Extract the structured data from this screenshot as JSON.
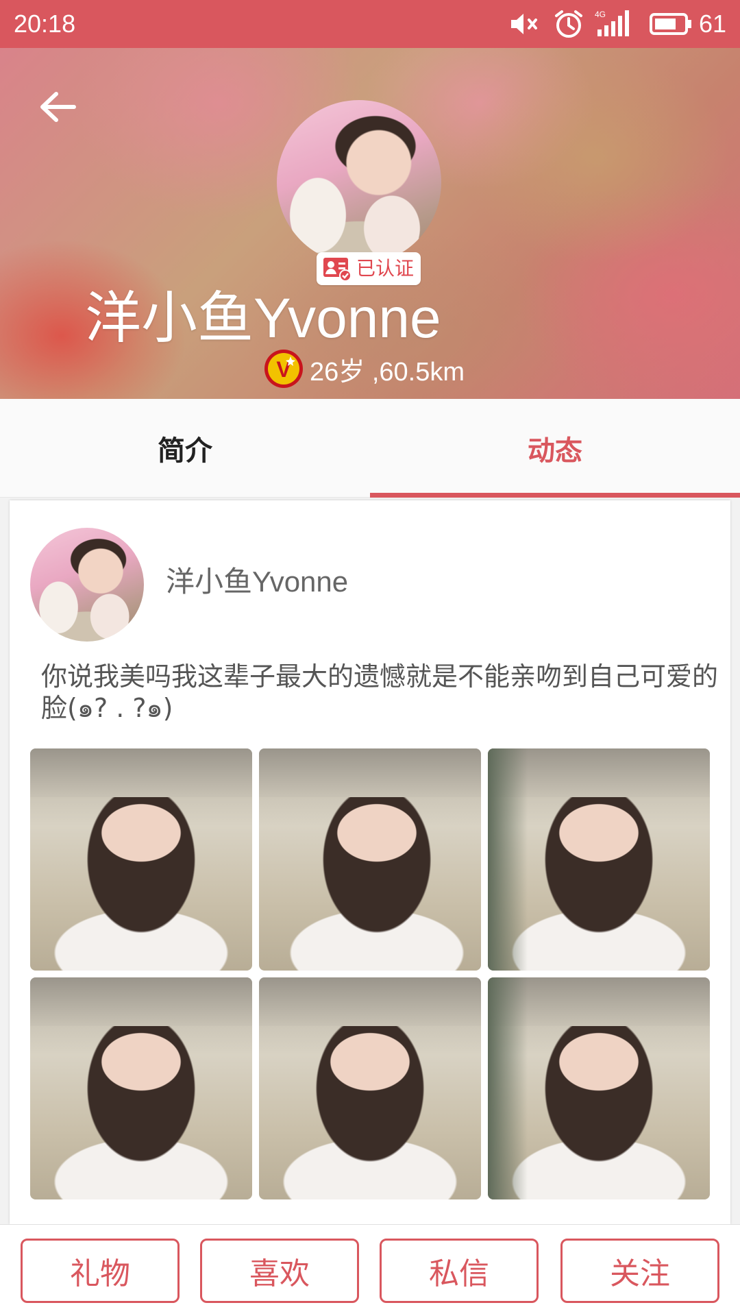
{
  "status_bar": {
    "time": "20:18",
    "network": "4G",
    "battery": "61",
    "icons": [
      "mute-icon",
      "alarm-icon",
      "signal-icon",
      "battery-icon"
    ]
  },
  "header": {
    "back_icon": "arrow-left-icon",
    "name": "洋小鱼Yvonne",
    "verified_label": "已认证",
    "vip_badge": "V",
    "meta": "26岁 ,60.5km"
  },
  "tabs": [
    {
      "label": "简介",
      "active": false
    },
    {
      "label": "动态",
      "active": true
    }
  ],
  "post": {
    "author": "洋小鱼Yvonne",
    "text": "你说我美吗我这辈子最大的遗憾就是不能亲吻到自己可爱的脸(๑? . ?๑)",
    "photo_count": 6
  },
  "actions": {
    "gift": "礼物",
    "like": "喜欢",
    "message": "私信",
    "follow": "关注"
  },
  "colors": {
    "accent": "#d9575e",
    "status_bar": "#d9575e",
    "tab_inactive": "#222222",
    "vip_yellow": "#f2c200"
  }
}
